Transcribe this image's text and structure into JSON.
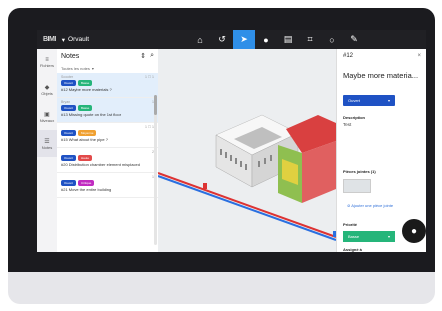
{
  "topbar": {
    "brand": "BIMI",
    "project": "Orvault",
    "tools": [
      "home-icon",
      "undo-icon",
      "pointer-icon",
      "pin-icon",
      "layers-icon",
      "crop-icon",
      "comment-icon",
      "measure-icon"
    ]
  },
  "rail": {
    "items": [
      {
        "label": "Fichiers",
        "icon": "≡"
      },
      {
        "label": "Objets",
        "icon": "◆"
      },
      {
        "label": "Niveaux",
        "icon": "▣"
      },
      {
        "label": "Notes",
        "icon": "☰"
      }
    ]
  },
  "notes": {
    "title": "Notes",
    "filter": "Toutes les notes",
    "items": [
      {
        "meta_left": "Scooter",
        "meta_right": "1 ☐ 1",
        "tags": [
          {
            "text": "Ouvert",
            "color": "#1f52c4"
          },
          {
            "text": "Basse",
            "color": "#25b57a"
          }
        ],
        "text": "#12 Maybe more materials ?",
        "selected": true
      },
      {
        "meta_left": "Bryan",
        "meta_right": "1",
        "tags": [
          {
            "text": "Ouvert",
            "color": "#1f52c4"
          },
          {
            "text": "Basse",
            "color": "#25b57a"
          }
        ],
        "text": "#13 Missing quote on the 1st floor",
        "selected": true
      },
      {
        "meta_left": "",
        "meta_right": "1 ☐ 1",
        "tags": [
          {
            "text": "Ouvert",
            "color": "#1f52c4"
          },
          {
            "text": "Moyenne",
            "color": "#f0a030"
          }
        ],
        "text": "#15 What about the pipe ?",
        "selected": false
      },
      {
        "meta_left": "",
        "meta_right": "2",
        "tags": [
          {
            "text": "Ouvert",
            "color": "#1f52c4"
          },
          {
            "text": "Haute",
            "color": "#e24a4a"
          }
        ],
        "text": "#20 Distribution chamber element misplaced",
        "selected": false
      },
      {
        "meta_left": "",
        "meta_right": "1",
        "tags": [
          {
            "text": "Ouvert",
            "color": "#1f52c4"
          },
          {
            "text": "Critique",
            "color": "#c02bc0"
          }
        ],
        "text": "#21 Move the entire building",
        "selected": false
      }
    ]
  },
  "detail": {
    "id": "#12",
    "title": "Maybe more materia...",
    "status": "Ouvert",
    "description_label": "Description",
    "description": "Test",
    "attachments_label": "Pièces jointes (1)",
    "add_attachment": "Ajouter une pièce jointe",
    "priority_label": "Priorité",
    "priority": "Basse",
    "assigned_label": "Assigné à"
  },
  "colors": {
    "accent": "#2f8fe8",
    "status_blue": "#1f52c4",
    "priority_green": "#25b57a"
  }
}
